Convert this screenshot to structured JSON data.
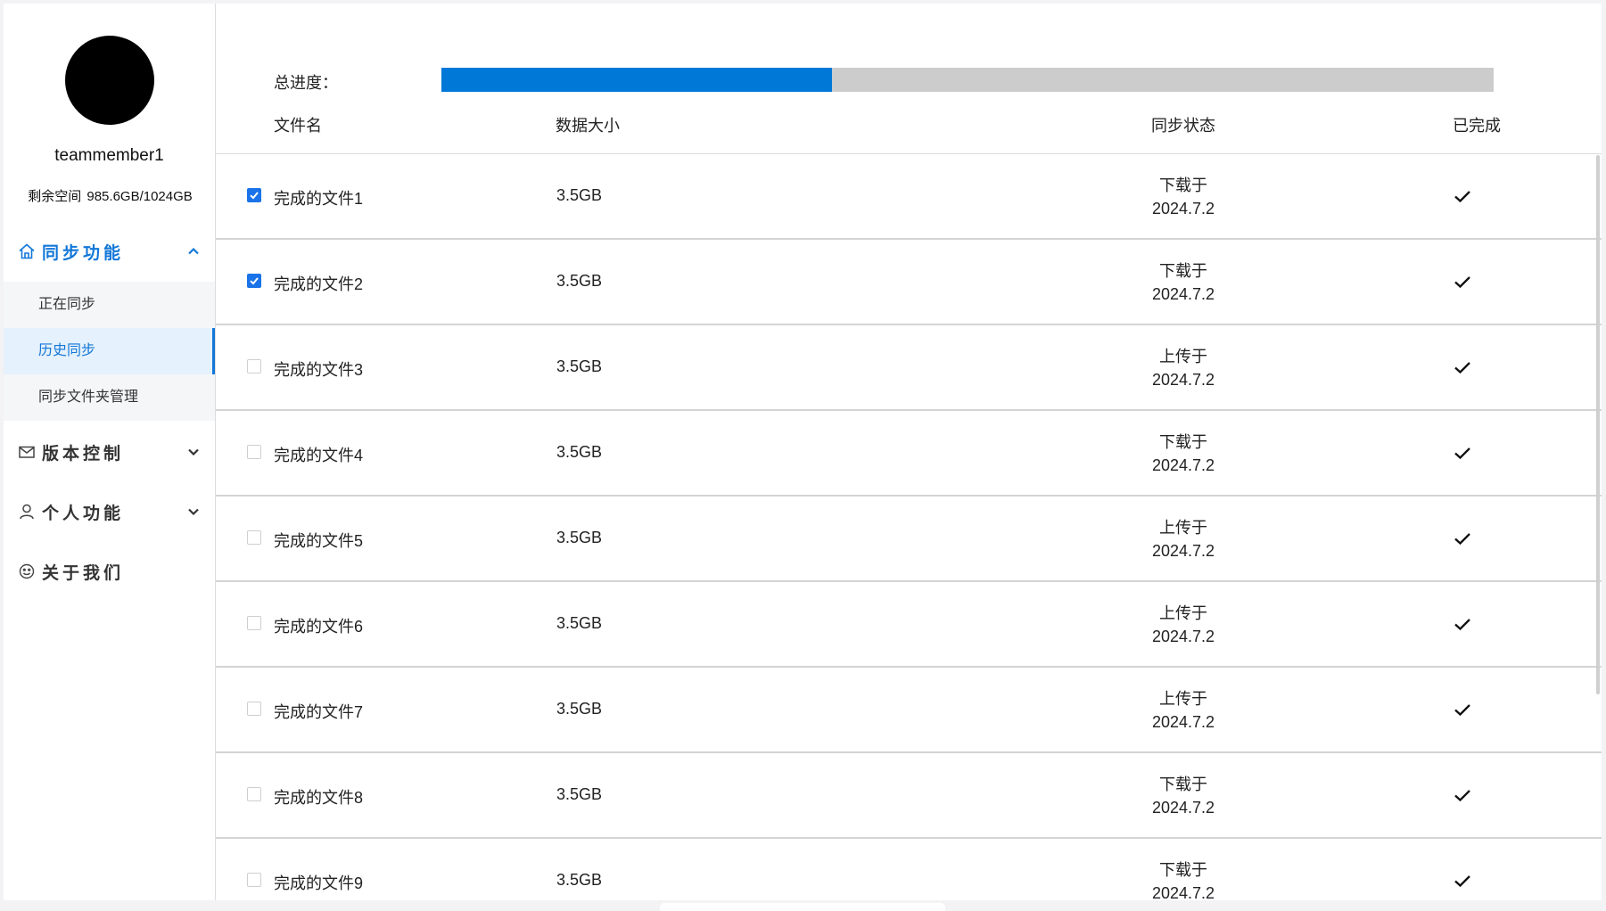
{
  "sidebar": {
    "username": "teammember1",
    "space_label": "剩余空间",
    "space_value": "985.6GB/1024GB",
    "menus": [
      {
        "label": "同步功能",
        "icon": "home-icon",
        "expanded": true
      },
      {
        "label": "版本控制",
        "icon": "mail-icon",
        "expanded": false
      },
      {
        "label": "个人功能",
        "icon": "user-icon",
        "expanded": false
      },
      {
        "label": "关于我们",
        "icon": "smile-icon"
      }
    ],
    "sync_submenu": [
      "正在同步",
      "历史同步",
      "同步文件夹管理"
    ],
    "active_submenu": "历史同步"
  },
  "progress": {
    "label": "总进度：",
    "fraction": 0.371
  },
  "table": {
    "headers": {
      "name": "文件名",
      "size": "数据大小",
      "status": "同步状态",
      "done": "已完成"
    },
    "rows": [
      {
        "name": "完成的文件1",
        "size": "3.5GB",
        "action": "下载于",
        "date": "2024.7.2",
        "checked": true
      },
      {
        "name": "完成的文件2",
        "size": "3.5GB",
        "action": "下载于",
        "date": "2024.7.2",
        "checked": true
      },
      {
        "name": "完成的文件3",
        "size": "3.5GB",
        "action": "上传于",
        "date": "2024.7.2",
        "checked": false
      },
      {
        "name": "完成的文件4",
        "size": "3.5GB",
        "action": "下载于",
        "date": "2024.7.2",
        "checked": false
      },
      {
        "name": "完成的文件5",
        "size": "3.5GB",
        "action": "上传于",
        "date": "2024.7.2",
        "checked": false
      },
      {
        "name": "完成的文件6",
        "size": "3.5GB",
        "action": "上传于",
        "date": "2024.7.2",
        "checked": false
      },
      {
        "name": "完成的文件7",
        "size": "3.5GB",
        "action": "上传于",
        "date": "2024.7.2",
        "checked": false
      },
      {
        "name": "完成的文件8",
        "size": "3.5GB",
        "action": "下载于",
        "date": "2024.7.2",
        "checked": false
      },
      {
        "name": "完成的文件9",
        "size": "3.5GB",
        "action": "下载于",
        "date": "2024.7.2",
        "checked": false
      }
    ]
  },
  "colors": {
    "accent": "#1277d8",
    "progress_fill": "#0078d7",
    "progress_track": "#cccccc"
  }
}
